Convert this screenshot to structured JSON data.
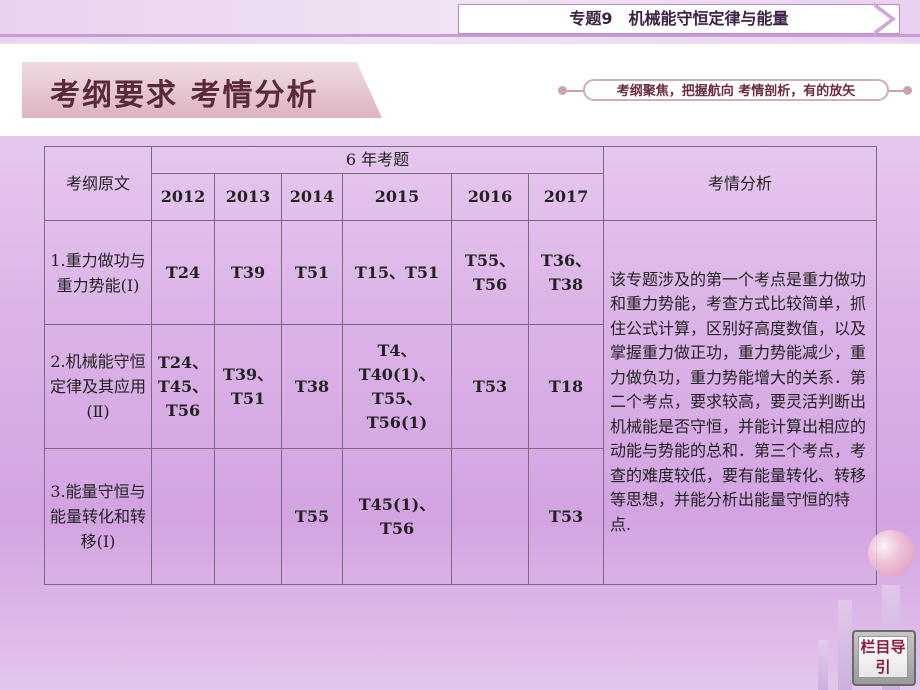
{
  "header": {
    "topic": "专题9　机械能守恒定律与能量",
    "section_title": "考纲要求  考情分析",
    "tagline": "考纲聚焦，把握航向  考情剖析，有的放矢"
  },
  "table": {
    "col_requirement": "考纲原文",
    "col_years_group": "6 年考题",
    "col_analysis": "考情分析",
    "years": [
      "2012",
      "2013",
      "2014",
      "2015",
      "2016",
      "2017"
    ],
    "rows": [
      {
        "requirement": "1.重力做功与重力势能(Ⅰ)",
        "cells": [
          "T24",
          "T39",
          "T51",
          "T15、T51",
          "T55、T56",
          "T36、T38"
        ]
      },
      {
        "requirement": "2.机械能守恒定律及其应用(Ⅱ)",
        "cells": [
          "T24、T45、T56",
          "T39、T51",
          "T38",
          "T4、T40(1)、T55、T56(1)",
          "T53",
          "T18"
        ]
      },
      {
        "requirement": "3.能量守恒与能量转化和转移(Ⅰ)",
        "cells": [
          "",
          "",
          "T55",
          "T45(1)、T56",
          "",
          "T53"
        ]
      }
    ],
    "analysis": "该专题涉及的第一个考点是重力做功和重力势能，考查方式比较简单，抓住公式计算，区别好高度数值，以及掌握重力做正功，重力势能减少，重力做负功，重力势能增大的关系．第二个考点，要求较高，要灵活判断出机械能是否守恒，并能计算出相应的动能与势能的总和．第三个考点，考查的难度较低，要有能量转化、转移等思想，并能分析出能量守恒的特点."
  },
  "nav": {
    "button_label": "栏目导引"
  }
}
